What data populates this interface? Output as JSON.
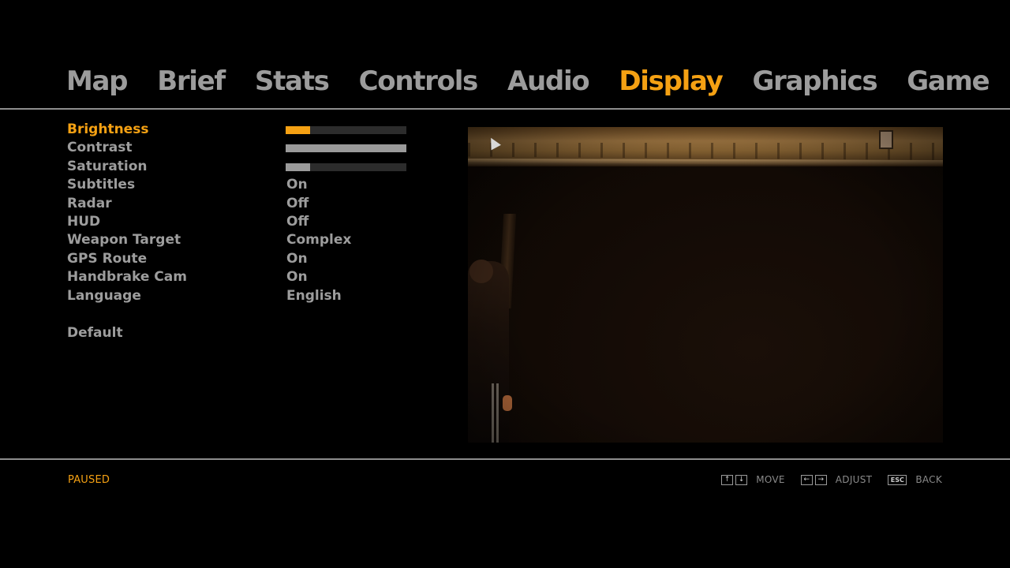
{
  "tabs": [
    {
      "label": "Map"
    },
    {
      "label": "Brief"
    },
    {
      "label": "Stats"
    },
    {
      "label": "Controls"
    },
    {
      "label": "Audio"
    },
    {
      "label": "Display",
      "active": true
    },
    {
      "label": "Graphics"
    },
    {
      "label": "Game"
    }
  ],
  "settings": [
    {
      "label": "Brightness",
      "type": "slider",
      "level": 0.2,
      "active": true
    },
    {
      "label": "Contrast",
      "type": "slider",
      "level": 1.0
    },
    {
      "label": "Saturation",
      "type": "slider",
      "level": 0.2
    },
    {
      "label": "Subtitles",
      "value": "On"
    },
    {
      "label": "Radar",
      "value": "Off"
    },
    {
      "label": "HUD",
      "value": "Off"
    },
    {
      "label": "Weapon Target",
      "value": "Complex"
    },
    {
      "label": "GPS Route",
      "value": "On"
    },
    {
      "label": "Handbrake Cam",
      "value": "On"
    },
    {
      "label": "Language",
      "value": "English"
    }
  ],
  "default_label": "Default",
  "footer": {
    "status": "PAUSED",
    "hints": [
      {
        "keys": [
          "↑",
          "↓"
        ],
        "label": "MOVE"
      },
      {
        "keys": [
          "←",
          "→"
        ],
        "label": "ADJUST"
      },
      {
        "keys": [
          "ESC"
        ],
        "label": "BACK"
      }
    ]
  },
  "colors": {
    "accent": "#f5a113",
    "text": "#9d9d9d",
    "background": "#000000"
  }
}
